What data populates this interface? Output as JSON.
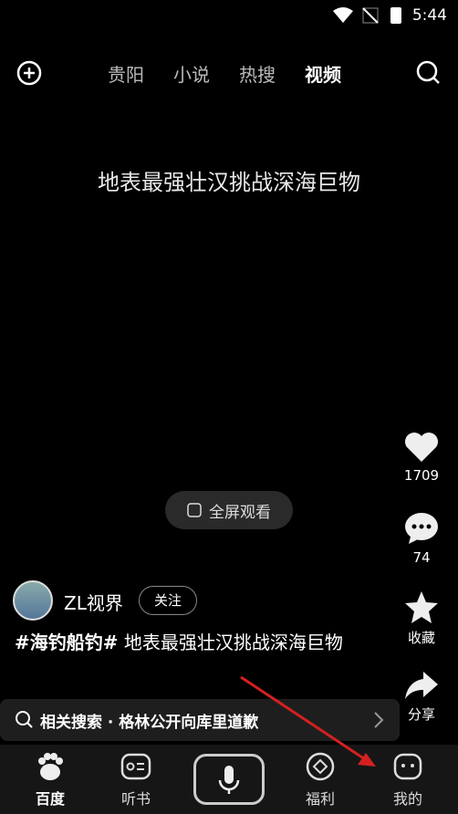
{
  "status": {
    "time": "5:44"
  },
  "topnav": {
    "tabs": [
      {
        "label": "贵阳"
      },
      {
        "label": "小说"
      },
      {
        "label": "热搜"
      },
      {
        "label": "视频",
        "active": true
      }
    ]
  },
  "video": {
    "title": "地表最强壮汉挑战深海巨物",
    "fullscreen_label": "全屏观看"
  },
  "side": {
    "likes": "1709",
    "comments": "74",
    "favorite": "收藏",
    "share": "分享"
  },
  "author": {
    "name": "ZL视界",
    "follow": "关注"
  },
  "desc": {
    "tag": "#海钓船钓#",
    "text": " 地表最强壮汉挑战深海巨物"
  },
  "related": {
    "text": "相关搜索 · 格林公开向库里道歉"
  },
  "bottom": {
    "items": [
      {
        "label": "百度"
      },
      {
        "label": "听书"
      },
      {
        "label": "福利"
      },
      {
        "label": "我的"
      }
    ]
  },
  "colors": {
    "arrow": "#d42020"
  }
}
